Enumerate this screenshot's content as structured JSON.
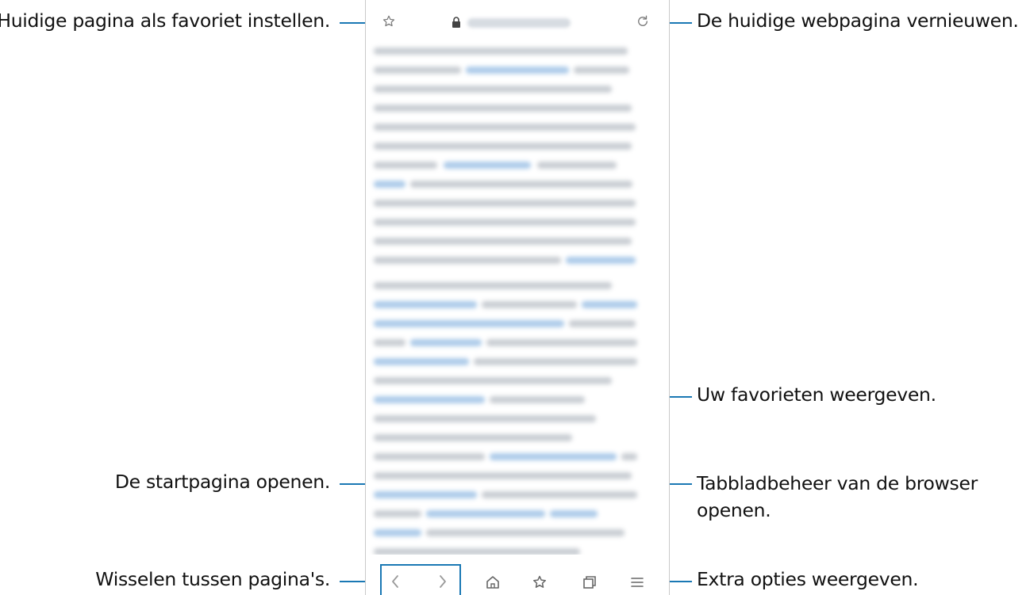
{
  "callouts": {
    "favorite_current": "Huidige pagina als favoriet instellen.",
    "refresh": "De huidige webpagina vernieuwen.",
    "view_bookmarks": "Uw favorieten weergeven.",
    "home_page": "De startpagina openen.",
    "tab_manager_line1": "Tabbladbeheer van de browser",
    "tab_manager_line2": "openen.",
    "switch_pages": "Wisselen tussen pagina's.",
    "extra_options": "Extra opties weergeven."
  },
  "icons": {
    "address_bar": [
      "star-outline-icon",
      "lock-icon",
      "refresh-icon"
    ],
    "bottom_bar": [
      "back-chevron-icon",
      "forward-chevron-icon",
      "home-icon",
      "bookmarks-icon",
      "tabs-icon",
      "menu-icon"
    ]
  },
  "colors": {
    "callout_line": "#1a78b4",
    "blurred_text": "#bfc4ca",
    "blurred_link": "#9cc1e6"
  }
}
